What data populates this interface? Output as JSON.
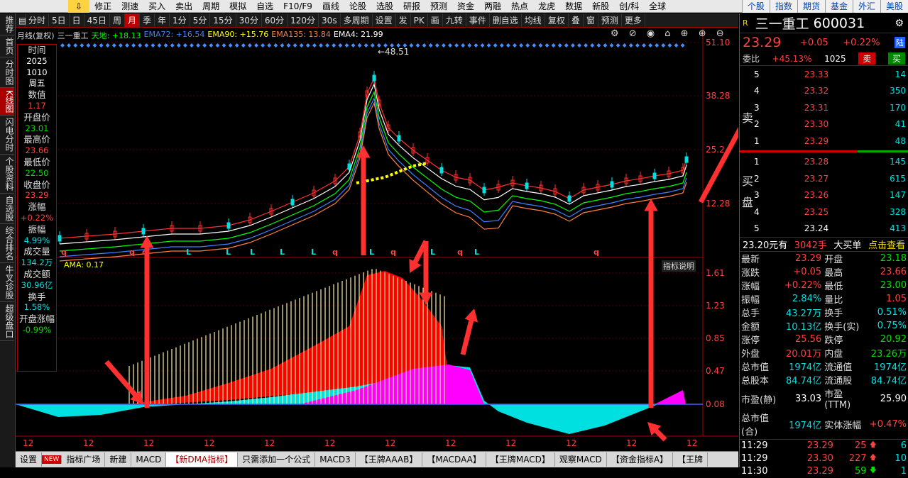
{
  "topbar": {
    "left_items": [
      "修正",
      "测速",
      "买入",
      "卖出",
      "周期",
      "模拟",
      "自选",
      "F10/F9",
      "画线",
      "论股",
      "选股",
      "研报",
      "预测",
      "资金",
      "两融",
      "热点",
      "龙虎",
      "数据",
      "新股",
      "创/科",
      "全球"
    ],
    "right_items": [
      "个股",
      "指数",
      "期货",
      "基金",
      "外汇",
      "美股"
    ]
  },
  "leftnav": [
    "推荐",
    "首页",
    "分时图",
    "K线图",
    "闪电分时",
    "个股资料",
    "自选股",
    "综合排名",
    "牛叉诊股",
    "超级盘口"
  ],
  "leftnav_active": 3,
  "toolbar": {
    "items": [
      "分时",
      "5日",
      "日",
      "45日",
      "周",
      "月",
      "季",
      "年",
      "1分",
      "5分",
      "15分",
      "30分",
      "60分",
      "120分",
      "30s",
      "多周期",
      "设置",
      "发",
      "PK",
      "画",
      "九转",
      "事件",
      "删自选",
      "均线",
      "复权",
      "叠",
      "窗",
      "预测",
      "更多"
    ],
    "active": 5
  },
  "legend": {
    "period": "月线(复权)",
    "name": "三一重工",
    "items": [
      {
        "label": "天地: +18.13",
        "color": "#00ff00"
      },
      {
        "label": "EMA72: +16.54",
        "color": "#4080ff"
      },
      {
        "label": "EMA90: +15.76",
        "color": "#ffff00"
      },
      {
        "label": "EMA135: 13.84",
        "color": "#ff8040"
      },
      {
        "label": "EMA4: 21.99",
        "color": "#ffffff"
      }
    ]
  },
  "yaxis_top": [
    "51.10",
    "38.28",
    "25.2",
    "12.28"
  ],
  "max_label": "48.51",
  "yaxis_bottom": [
    "1.61",
    "1.23",
    "0.85",
    "0.47",
    "0.08"
  ],
  "xaxis": [
    "12",
    "12",
    "12",
    "12",
    "12",
    "12",
    "12",
    "12",
    "12",
    "12",
    "12",
    "12"
  ],
  "ama_label": "AMA: 0.17",
  "indicator_btn": "指标说明",
  "infobox": [
    {
      "k": "时间",
      "v": "2025\n1010\n周五",
      "vc": "#fff"
    },
    {
      "k": "数值",
      "v": "1.17",
      "vc": "#ff4040"
    },
    {
      "k": "开盘价",
      "v": "23.01",
      "vc": "#00e000"
    },
    {
      "k": "最高价",
      "v": "23.66",
      "vc": "#ff4040"
    },
    {
      "k": "最低价",
      "v": "22.50",
      "vc": "#00e000"
    },
    {
      "k": "收盘价",
      "v": "23.29",
      "vc": "#ff4040"
    },
    {
      "k": "涨幅",
      "v": "+0.22%",
      "vc": "#ff4040"
    },
    {
      "k": "振幅",
      "v": "4.99%",
      "vc": "#00e0e0"
    },
    {
      "k": "成交量",
      "v": "134.2万",
      "vc": "#00e0e0"
    },
    {
      "k": "成交额",
      "v": "30.96亿",
      "vc": "#00e0e0"
    },
    {
      "k": "换手",
      "v": "1.58%",
      "vc": "#00e0e0"
    },
    {
      "k": "开盘涨幅",
      "v": "-0.99%",
      "vc": "#00e000"
    }
  ],
  "bottombar": [
    "设置",
    "NEW",
    "指标广场",
    "新建",
    "MACD",
    "【新DMA指标】",
    "只需添加一个公式",
    "MACD3",
    "【王牌AAAB】",
    "【MACDAA】",
    "【王牌MACD】",
    "观察MACD",
    "【资金指标A】",
    "【王牌"
  ],
  "bottombar_active": 5,
  "stock": {
    "name": "三一重工",
    "code": "600031",
    "price": "23.29",
    "change": "+0.05",
    "pct": "+0.22%",
    "market": "陆",
    "weibi_label": "委比",
    "weibi": "+45.13%",
    "weibi_vol": "1025",
    "sell_btn": "卖",
    "buy_btn": "买",
    "sell_label": "卖",
    "buy_label": "买盘",
    "asks": [
      {
        "lvl": "5",
        "p": "23.33",
        "v": "14"
      },
      {
        "lvl": "4",
        "p": "23.32",
        "v": "350"
      },
      {
        "lvl": "3",
        "p": "23.31",
        "v": "170"
      },
      {
        "lvl": "2",
        "p": "23.30",
        "v": "41"
      },
      {
        "lvl": "1",
        "p": "23.29",
        "v": "48"
      }
    ],
    "bids": [
      {
        "lvl": "1",
        "p": "23.28",
        "v": "145"
      },
      {
        "lvl": "2",
        "p": "23.27",
        "v": "615"
      },
      {
        "lvl": "3",
        "p": "23.26",
        "v": "147"
      },
      {
        "lvl": "4",
        "p": "23.25",
        "v": "328"
      },
      {
        "lvl": "5",
        "p": "23.24",
        "v": "413"
      }
    ],
    "bigorder": {
      "a": "23.20元有",
      "b": "3042手",
      "c": "大买单",
      "d": "点击查看"
    },
    "quote": [
      [
        "最新",
        "23.29",
        "开盘",
        "23.18"
      ],
      [
        "涨跌",
        "+0.05",
        "最高",
        "23.66"
      ],
      [
        "涨幅",
        "+0.22%",
        "最低",
        "23.00"
      ],
      [
        "振幅",
        "2.84%",
        "量比",
        "1.05"
      ],
      [
        "总手",
        "43.27万",
        "换手",
        "0.51%"
      ],
      [
        "金额",
        "10.13亿",
        "换手(实)",
        "0.75%"
      ],
      [
        "涨停",
        "25.56",
        "跌停",
        "20.92"
      ],
      [
        "外盘",
        "20.01万",
        "内盘",
        "23.26万"
      ],
      [
        "总市值",
        "1974亿",
        "流通值",
        "1974亿"
      ],
      [
        "总股本",
        "84.74亿",
        "流通股",
        "84.74亿"
      ],
      [
        "市盈(静)",
        "33.03",
        "市盈(TTM)",
        "25.90"
      ],
      [
        "总市值(合)",
        "1974亿",
        "实体涨幅",
        "+0.47%"
      ]
    ],
    "ticks": [
      {
        "t": "11:29",
        "p": "23.29",
        "v": "25",
        "dir": "up",
        "n": "6"
      },
      {
        "t": "11:29",
        "p": "23.30",
        "v": "227",
        "dir": "up",
        "n": "10"
      },
      {
        "t": "11:30",
        "p": "23.29",
        "v": "59",
        "dir": "down",
        "n": "1"
      }
    ]
  }
}
